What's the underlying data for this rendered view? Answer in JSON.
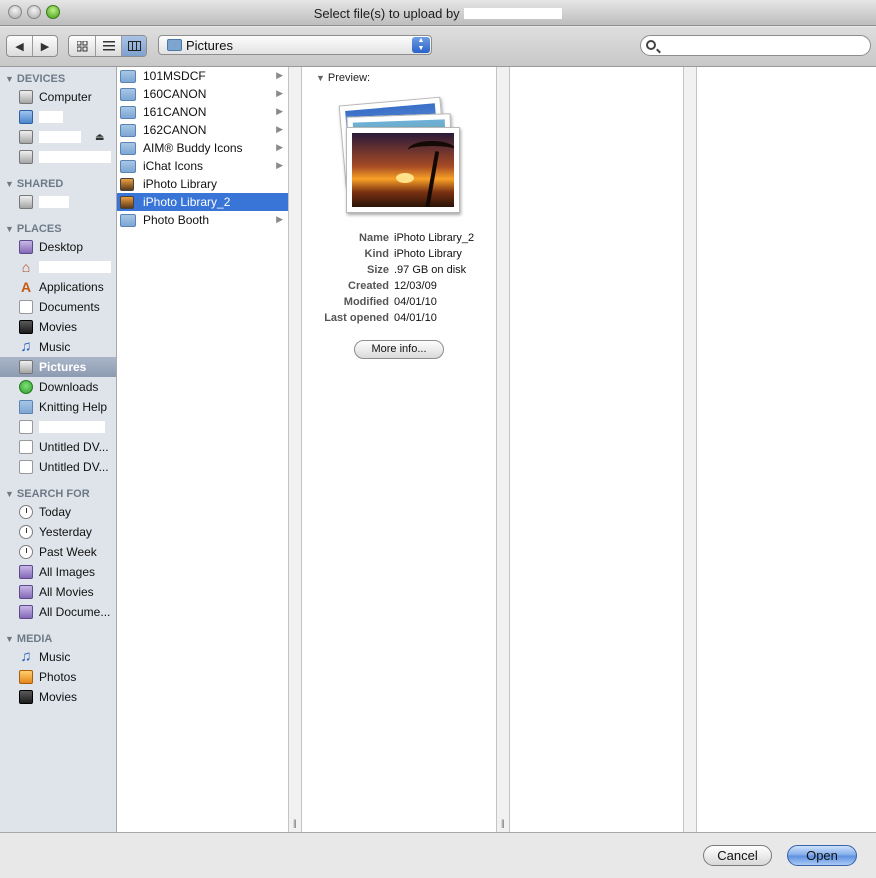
{
  "window": {
    "title": "Select file(s) to upload by"
  },
  "toolbar": {
    "back_glyph": "◀",
    "forward_glyph": "▶",
    "view_icons": [
      "icon-view-icon",
      "list-view-icon",
      "column-view-icon"
    ],
    "location": "Pictures",
    "location_arrows": "▲\n▼",
    "search_placeholder": ""
  },
  "sidebar": {
    "sections": [
      {
        "title": "DEVICES"
      },
      {
        "title": "SHARED"
      },
      {
        "title": "PLACES"
      },
      {
        "title": "SEARCH FOR"
      },
      {
        "title": "MEDIA"
      }
    ],
    "devices": [
      "Computer"
    ],
    "places": [
      "Desktop",
      "Applications",
      "Documents",
      "Movies",
      "Music",
      "Pictures",
      "Downloads",
      "Knitting Help",
      "Untitled DV...",
      "Untitled DV..."
    ],
    "search_for": [
      "Today",
      "Yesterday",
      "Past Week",
      "All Images",
      "All Movies",
      "All Docume..."
    ],
    "media": [
      "Music",
      "Photos",
      "Movies"
    ],
    "selected": "Pictures"
  },
  "browser": {
    "column1": [
      {
        "name": "101MSDCF",
        "kind": "folder",
        "arrow": "▶"
      },
      {
        "name": "160CANON",
        "kind": "folder",
        "arrow": "▶"
      },
      {
        "name": "161CANON",
        "kind": "folder",
        "arrow": "▶"
      },
      {
        "name": "162CANON",
        "kind": "folder",
        "arrow": "▶"
      },
      {
        "name": "AIM® Buddy Icons",
        "kind": "folder",
        "arrow": "▶"
      },
      {
        "name": "iChat Icons",
        "kind": "folder",
        "arrow": "▶"
      },
      {
        "name": "iPhoto Library",
        "kind": "library",
        "arrow": ""
      },
      {
        "name": "iPhoto Library_2",
        "kind": "library",
        "arrow": ""
      },
      {
        "name": "Photo Booth",
        "kind": "folder",
        "arrow": "▶"
      }
    ],
    "selected": "iPhoto Library_2",
    "grip": "||"
  },
  "preview": {
    "label": "Preview:",
    "info": [
      {
        "key": "Name",
        "value": "iPhoto Library_2"
      },
      {
        "key": "Kind",
        "value": "iPhoto Library"
      },
      {
        "key": "Size",
        "value": ".97 GB on disk"
      },
      {
        "key": "Created",
        "value": "12/03/09"
      },
      {
        "key": "Modified",
        "value": "04/01/10"
      },
      {
        "key": "Last opened",
        "value": "04/01/10"
      }
    ],
    "more_info_label": "More info..."
  },
  "footer": {
    "cancel_label": "Cancel",
    "open_label": "Open"
  },
  "colors": {
    "selection": "#3875d7",
    "sidebar_bg": "#dee4ea",
    "default_button": "#5b8fe0"
  }
}
